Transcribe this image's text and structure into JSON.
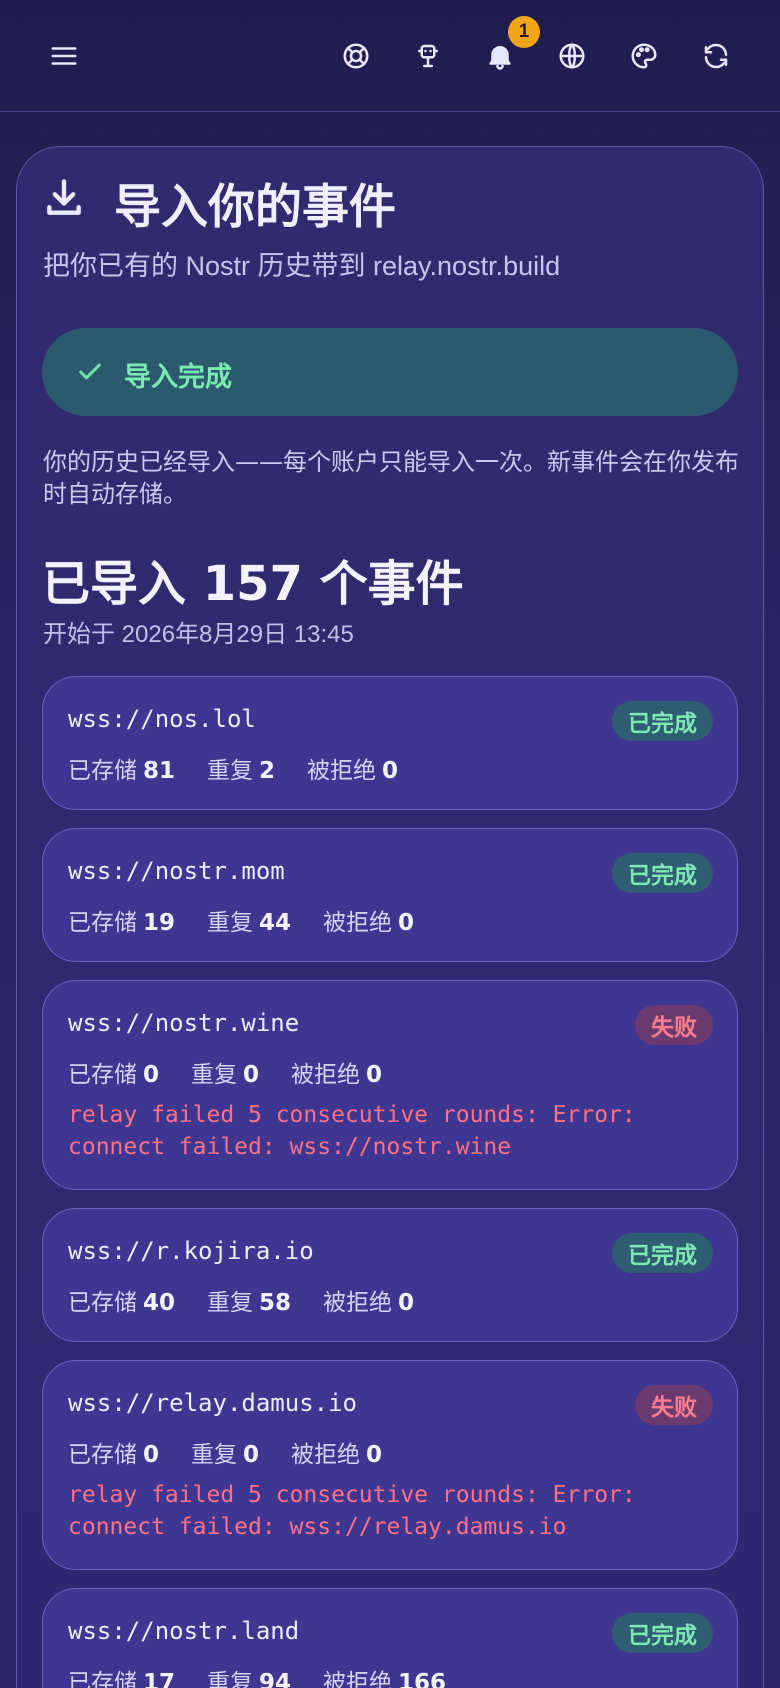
{
  "header": {
    "icons": [
      "menu-icon",
      "support-icon",
      "robot-icon",
      "bell-icon",
      "globe-icon",
      "palette-icon",
      "refresh-icon"
    ],
    "notification_count": "1"
  },
  "page": {
    "title": "导入你的事件",
    "subtitle": "把你已有的 Nostr 历史带到 relay.nostr.build",
    "status_label": "导入完成",
    "description": "你的历史已经导入——每个账户只能导入一次。新事件会在你发布时自动存储。",
    "imported_count": "已导入 157 个事件",
    "started_at": "开始于 2026年8月29日 13:45"
  },
  "labels": {
    "stored": "已存储",
    "duplicate": "重复",
    "rejected": "被拒绝"
  },
  "relays": [
    {
      "url": "wss://nos.lol",
      "status": "已完成",
      "stored": "81",
      "duplicate": "2",
      "rejected": "0",
      "error": ""
    },
    {
      "url": "wss://nostr.mom",
      "status": "已完成",
      "stored": "19",
      "duplicate": "44",
      "rejected": "0",
      "error": ""
    },
    {
      "url": "wss://nostr.wine",
      "status": "失败",
      "stored": "0",
      "duplicate": "0",
      "rejected": "0",
      "error": "relay failed 5 consecutive rounds: Error: connect failed: wss://nostr.wine"
    },
    {
      "url": "wss://r.kojira.io",
      "status": "已完成",
      "stored": "40",
      "duplicate": "58",
      "rejected": "0",
      "error": ""
    },
    {
      "url": "wss://relay.damus.io",
      "status": "失败",
      "stored": "0",
      "duplicate": "0",
      "rejected": "0",
      "error": "relay failed 5 consecutive rounds: Error: connect failed: wss://relay.damus.io"
    },
    {
      "url": "wss://nostr.land",
      "status": "已完成",
      "stored": "17",
      "duplicate": "94",
      "rejected": "166",
      "error": ""
    }
  ],
  "colors": {
    "background": "#2a2260",
    "success": "#7beab2",
    "failure": "#ff7183",
    "notification_badge": "#f3a51a"
  }
}
